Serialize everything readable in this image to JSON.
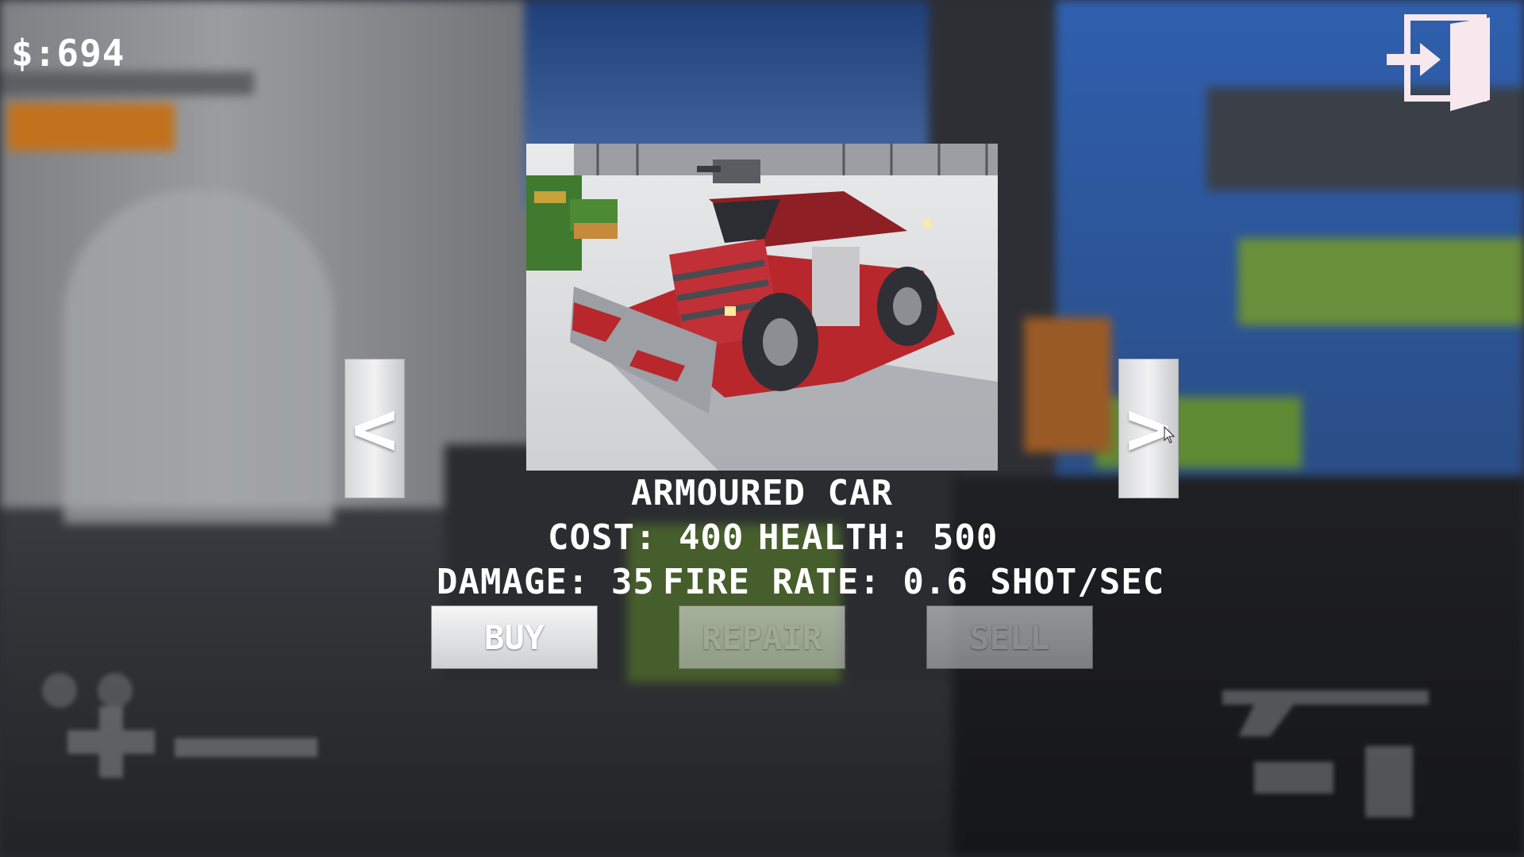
{
  "hud": {
    "money": "$:694"
  },
  "shop": {
    "prev_label": "<",
    "next_label": ">",
    "car": {
      "name": "ARMOURED CAR",
      "cost": "COST: 400",
      "health": "HEALTH: 500",
      "damage": "DAMAGE: 35",
      "fire_rate": "FIRE RATE: 0.6 SHOT/SEC"
    },
    "buttons": {
      "buy": "BUY",
      "repair": "REPAIR",
      "sell": "SELL"
    }
  },
  "icons": {
    "exit": "exit-door-icon",
    "prev": "chevron-left-icon",
    "next": "chevron-right-icon"
  },
  "colors": {
    "car_body": "#b8272c",
    "ui_text": "#ffffff",
    "button_face": "#e6e6e8"
  }
}
